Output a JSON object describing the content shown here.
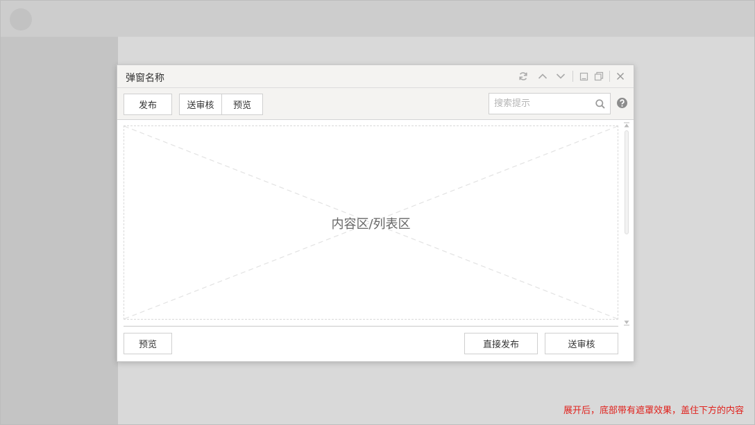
{
  "dialog": {
    "title": "弹窗名称",
    "header_icons": [
      "refresh-icon",
      "chevron-up-icon",
      "chevron-down-icon",
      "minimize-icon",
      "restore-icon",
      "close-icon"
    ]
  },
  "toolbar": {
    "publish_label": "发布",
    "submit_review_label": "送审核",
    "preview_label": "预览",
    "search_placeholder": "搜索提示"
  },
  "content": {
    "placeholder_label": "内容区/列表区"
  },
  "footer": {
    "preview_label": "预览",
    "direct_publish_label": "直接发布",
    "submit_review_label": "送审核"
  },
  "note": "展开后，底部带有遮罩效果，盖住下方的内容",
  "colors": {
    "note_text": "#e0201b",
    "header_bg": "#f4f3f1",
    "backdrop": "#d6d6d6"
  }
}
